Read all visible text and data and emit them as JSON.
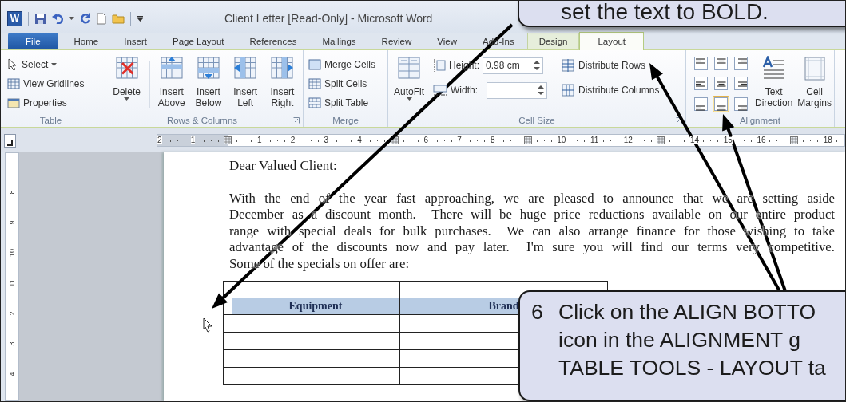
{
  "title_bar": {
    "app_icon": "W",
    "title": "Client Letter [Read-Only] - Microsoft Word"
  },
  "tabs": [
    {
      "label": "File",
      "kind": "file",
      "selected": false
    },
    {
      "label": "Home",
      "kind": "normal",
      "selected": false
    },
    {
      "label": "Insert",
      "kind": "normal",
      "selected": false
    },
    {
      "label": "Page Layout",
      "kind": "normal",
      "selected": false
    },
    {
      "label": "References",
      "kind": "normal",
      "selected": false
    },
    {
      "label": "Mailings",
      "kind": "normal",
      "selected": false
    },
    {
      "label": "Review",
      "kind": "normal",
      "selected": false
    },
    {
      "label": "View",
      "kind": "normal",
      "selected": false
    },
    {
      "label": "Add-Ins",
      "kind": "normal",
      "selected": false
    },
    {
      "label": "Design",
      "kind": "contextual",
      "selected": false
    },
    {
      "label": "Layout",
      "kind": "contextual",
      "selected": true
    }
  ],
  "ribbon": {
    "table_group": {
      "label": "Table",
      "items": [
        {
          "label": "Select",
          "kind": "select",
          "dropdown": true
        },
        {
          "label": "View Gridlines",
          "kind": "gridlines",
          "dropdown": false
        },
        {
          "label": "Properties",
          "kind": "properties",
          "dropdown": false
        }
      ]
    },
    "rows_columns": {
      "label": "Rows & Columns",
      "buttons": [
        {
          "label": "Delete",
          "kind": "delete",
          "dropdown": true
        },
        {
          "label": "Insert Above",
          "kind": "above",
          "dropdown": false
        },
        {
          "label": "Insert Below",
          "kind": "below",
          "dropdown": false
        },
        {
          "label": "Insert Left",
          "kind": "left",
          "dropdown": false
        },
        {
          "label": "Insert Right",
          "kind": "right",
          "dropdown": false
        }
      ]
    },
    "merge": {
      "label": "Merge",
      "items": [
        {
          "label": "Merge Cells",
          "kind": "merge"
        },
        {
          "label": "Split Cells",
          "kind": "split"
        },
        {
          "label": "Split Table",
          "kind": "split-table"
        }
      ]
    },
    "cell_size": {
      "label": "Cell Size",
      "autofit": "AutoFit",
      "height_label": "Height:",
      "height_value": "0.98 cm",
      "width_label": "Width:",
      "distribute": [
        {
          "label": "Distribute Rows",
          "kind": "rows"
        },
        {
          "label": "Distribute Columns",
          "kind": "columns"
        }
      ]
    },
    "alignment": {
      "label": "Alignment",
      "buttons": [
        {
          "selected": false
        },
        {
          "selected": false
        },
        {
          "selected": false
        },
        {
          "selected": false
        },
        {
          "selected": false
        },
        {
          "selected": false
        },
        {
          "selected": false
        },
        {
          "selected": true
        },
        {
          "selected": false
        }
      ],
      "text_direction": "Text Direction",
      "cell_margins": "Cell Margins"
    }
  },
  "ruler": {
    "marks": [
      {
        "kind": "number",
        "label": "2"
      },
      {
        "kind": "number",
        "label": "1"
      },
      {
        "kind": "mark"
      },
      {
        "kind": "number",
        "label": "1"
      },
      {
        "kind": "number",
        "label": "2"
      },
      {
        "kind": "number",
        "label": "3"
      },
      {
        "kind": "number",
        "label": "4"
      },
      {
        "kind": "mark"
      },
      {
        "kind": "number",
        "label": "6"
      },
      {
        "kind": "number",
        "label": "7"
      },
      {
        "kind": "number",
        "label": "8"
      },
      {
        "kind": "mark"
      },
      {
        "kind": "number",
        "label": "10"
      },
      {
        "kind": "number",
        "label": "11"
      },
      {
        "kind": "number",
        "label": "12"
      },
      {
        "kind": "mark"
      },
      {
        "kind": "number",
        "label": "14"
      },
      {
        "kind": "number",
        "label": "15"
      },
      {
        "kind": "number",
        "label": "16"
      },
      {
        "kind": "mark"
      },
      {
        "kind": "number",
        "label": "18"
      }
    ]
  },
  "vertical_ruler": {
    "labels": [
      "8",
      "9",
      "10",
      "11",
      "2",
      "3",
      "4"
    ]
  },
  "document": {
    "salutation": "Dear Valued Client:",
    "paragraph_lines": [
      "With the end of the year fast approaching, we are pleased to announce that we are setting aside",
      "December as a discount month.  There will be huge price reductions available on our entire product",
      "range with special deals for bulk purchases.  We can also arrange finance for those wishing to take",
      "advantage of the discounts now and pay later.  I'm sure you will find our terms very competitive.",
      "Some of the specials on offer are:"
    ],
    "table": {
      "columns": [
        "Equipment",
        "Brand"
      ]
    }
  },
  "callouts": [
    {
      "kind": "top",
      "lines": [
        "set the text to BOLD."
      ]
    },
    {
      "kind": "bottom",
      "number": "6",
      "lines": [
        "Click on the ALIGN BOTTO",
        "icon in the ALIGNMENT g",
        "TABLE TOOLS - LAYOUT ta"
      ]
    }
  ]
}
